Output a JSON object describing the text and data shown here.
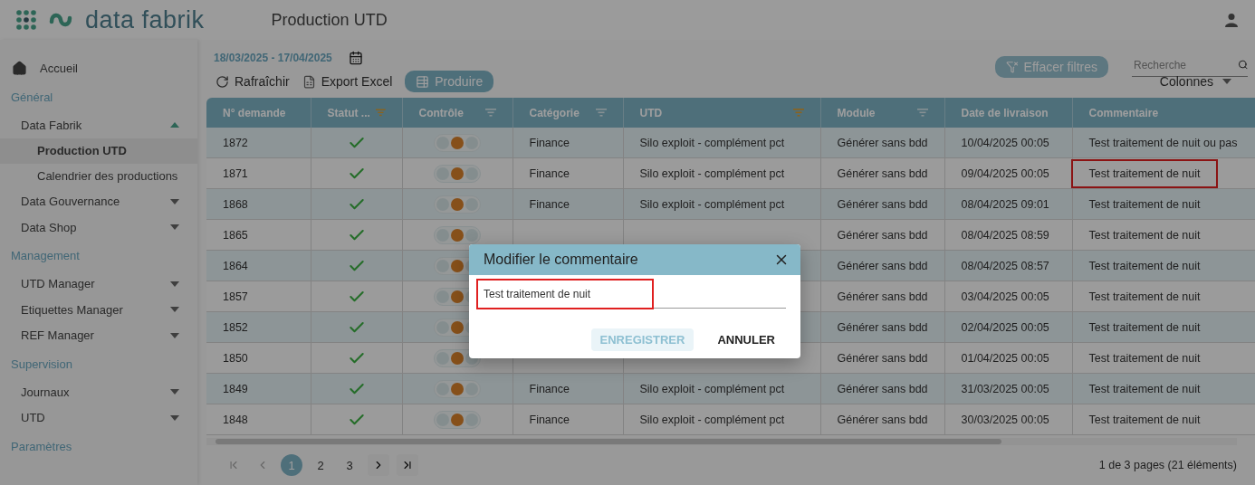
{
  "header": {
    "logo": "data fabrik",
    "title": "Production UTD"
  },
  "sidebar": [
    {
      "kind": "link",
      "label": "Accueil"
    },
    {
      "kind": "section",
      "label": "Général"
    },
    {
      "kind": "group",
      "label": "Data Fabrik",
      "expanded": true,
      "children": [
        {
          "label": "Production UTD",
          "selected": true
        },
        {
          "label": "Calendrier des productions",
          "selected": false
        }
      ]
    },
    {
      "kind": "group",
      "label": "Data Gouvernance",
      "expanded": false
    },
    {
      "kind": "group",
      "label": "Data Shop",
      "expanded": false
    },
    {
      "kind": "section",
      "label": "Management"
    },
    {
      "kind": "group",
      "label": "UTD Manager",
      "expanded": false
    },
    {
      "kind": "group",
      "label": "Etiquettes Manager",
      "expanded": false
    },
    {
      "kind": "group",
      "label": "REF Manager",
      "expanded": false
    },
    {
      "kind": "section",
      "label": "Supervision"
    },
    {
      "kind": "group",
      "label": "Journaux",
      "expanded": false
    },
    {
      "kind": "group",
      "label": "UTD",
      "expanded": false
    },
    {
      "kind": "section",
      "label": "Paramètres"
    }
  ],
  "toolbar": {
    "date_range": "18/03/2025 - 17/04/2025",
    "actions": [
      {
        "kind": "refresh",
        "label": "Rafraîchir"
      },
      {
        "kind": "export",
        "label": "Export Excel"
      },
      {
        "kind": "produce",
        "label": "Produire"
      }
    ],
    "clear_filters": {
      "label": "Effacer filtres",
      "disabled": true
    },
    "search": {
      "placeholder": "Recherche"
    },
    "columns_menu": "Colonnes"
  },
  "table": {
    "columns": [
      {
        "label": "N° demande",
        "filterable": false
      },
      {
        "label": "Statut ...",
        "filterable": true,
        "filter_active": true
      },
      {
        "label": "Contrôle",
        "filterable": true,
        "filter_active": false
      },
      {
        "label": "Catégorie",
        "filterable": true,
        "filter_active": false
      },
      {
        "label": "UTD",
        "filterable": true,
        "filter_active": true
      },
      {
        "label": "Module",
        "filterable": true,
        "filter_active": false
      },
      {
        "label": "Date de livraison",
        "filterable": false
      },
      {
        "label": "Commentaire",
        "filterable": false
      }
    ],
    "rows": [
      {
        "id": "1872",
        "ok": true,
        "control_warning": true,
        "category": "Finance",
        "utd": "Silo exploit - complément pct",
        "module": "Générer sans bdd",
        "date": "10/04/2025 00:05",
        "comment": "Test traitement de nuit ou pas",
        "highlighted": false
      },
      {
        "id": "1871",
        "ok": true,
        "control_warning": true,
        "category": "Finance",
        "utd": "Silo exploit - complément pct",
        "module": "Générer sans bdd",
        "date": "09/04/2025 00:05",
        "comment": "Test traitement de nuit",
        "highlighted": true
      },
      {
        "id": "1868",
        "ok": true,
        "control_warning": true,
        "category": "Finance",
        "utd": "Silo exploit - complément pct",
        "module": "Générer sans bdd",
        "date": "08/04/2025 09:01",
        "comment": "Test traitement de nuit",
        "highlighted": false
      },
      {
        "id": "1865",
        "ok": true,
        "control_warning": true,
        "module": "Générer sans bdd",
        "date": "08/04/2025 08:59",
        "comment": "Test traitement de nuit",
        "highlighted": false
      },
      {
        "id": "1864",
        "ok": true,
        "control_warning": true,
        "module": "Générer sans bdd",
        "date": "08/04/2025 08:57",
        "comment": "Test traitement de nuit",
        "highlighted": false
      },
      {
        "id": "1857",
        "ok": true,
        "control_warning": true,
        "module": "Générer sans bdd",
        "date": "03/04/2025 00:05",
        "comment": "Test traitement de nuit",
        "highlighted": false
      },
      {
        "id": "1852",
        "ok": true,
        "control_warning": true,
        "module": "Générer sans bdd",
        "date": "02/04/2025 00:05",
        "comment": "Test traitement de nuit",
        "highlighted": false
      },
      {
        "id": "1850",
        "ok": true,
        "control_warning": true,
        "module": "Générer sans bdd",
        "date": "01/04/2025 00:05",
        "comment": "Test traitement de nuit",
        "highlighted": false
      },
      {
        "id": "1849",
        "ok": true,
        "control_warning": true,
        "category": "Finance",
        "utd": "Silo exploit - complément pct",
        "module": "Générer sans bdd",
        "date": "31/03/2025 00:05",
        "comment": "Test traitement de nuit",
        "highlighted": false
      },
      {
        "id": "1848",
        "ok": true,
        "control_warning": true,
        "category": "Finance",
        "utd": "Silo exploit - complément pct",
        "module": "Générer sans bdd",
        "date": "30/03/2025 00:05",
        "comment": "Test traitement de nuit",
        "highlighted": false
      }
    ]
  },
  "pagination": {
    "nav": [
      {
        "kind": "first",
        "disabled": true
      },
      {
        "kind": "prev",
        "disabled": true
      },
      {
        "kind": "page",
        "label": "1",
        "selected": true
      },
      {
        "kind": "page",
        "label": "2",
        "selected": false
      },
      {
        "kind": "page",
        "label": "3",
        "selected": false
      },
      {
        "kind": "next",
        "disabled": false
      },
      {
        "kind": "last",
        "disabled": false
      }
    ],
    "info": "1 de 3 pages (21 éléments)"
  },
  "dialog": {
    "title": "Modifier le commentaire",
    "value": "Test traitement de nuit",
    "highlighted": true,
    "buttons": [
      {
        "label": "ENREGISTRER",
        "disabled": true
      },
      {
        "label": "ANNULER",
        "disabled": false
      }
    ]
  }
}
